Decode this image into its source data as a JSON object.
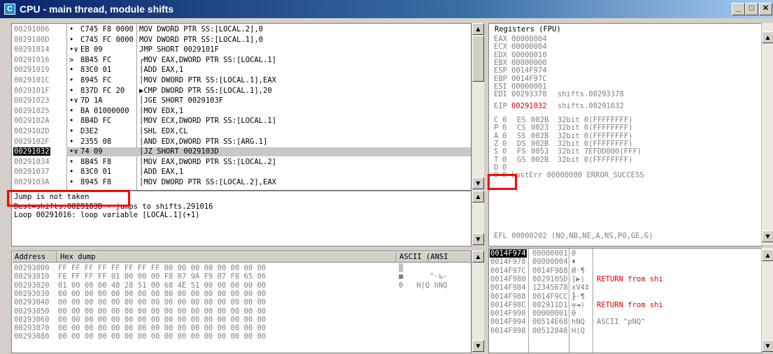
{
  "window": {
    "title": "CPU - main thread, module shifts",
    "icon_letter": "C",
    "minimize": "_",
    "maximize": "□",
    "close": "✕"
  },
  "disasm": {
    "rows": [
      {
        "addr": "00291006",
        "mark": "•",
        "bytes": "C745 F8 0000",
        "instr": "MOV DWORD PTR SS:[LOCAL.2],0"
      },
      {
        "addr": "0029100D",
        "mark": "•",
        "bytes": "C745 FC 0000",
        "instr": "MOV DWORD PTR SS:[LOCAL.1],0"
      },
      {
        "addr": "00291014",
        "mark": "•∨",
        "bytes": "EB 09",
        "instr": "JMP SHORT 0029101F"
      },
      {
        "addr": "00291016",
        "mark": ">",
        "bytes": "8B45 FC",
        "instr": "┌MOV EAX,DWORD PTR SS:[LOCAL.1]"
      },
      {
        "addr": "00291019",
        "mark": "•",
        "bytes": "83C0 01",
        "instr": "│ADD EAX,1"
      },
      {
        "addr": "0029101C",
        "mark": "•",
        "bytes": "8945 FC",
        "instr": "│MOV DWORD PTR SS:[LOCAL.1],EAX"
      },
      {
        "addr": "0029101F",
        "mark": "•",
        "bytes": "837D FC 20",
        "instr": "▶CMP DWORD PTR SS:[LOCAL.1],20"
      },
      {
        "addr": "00291023",
        "mark": "•∨",
        "bytes": "7D 1A",
        "instr": "│JGE SHORT 0029103F"
      },
      {
        "addr": "00291025",
        "mark": "•",
        "bytes": "BA 01000000",
        "instr": "│MOV EDX,1"
      },
      {
        "addr": "0029102A",
        "mark": "•",
        "bytes": "8B4D FC",
        "instr": "│MOV ECX,DWORD PTR SS:[LOCAL.1]"
      },
      {
        "addr": "0029102D",
        "mark": "•",
        "bytes": "D3E2",
        "instr": "│SHL EDX,CL"
      },
      {
        "addr": "0029102F",
        "mark": "•",
        "bytes": "2355 08",
        "instr": "│AND EDX,DWORD PTR SS:[ARG.1]"
      },
      {
        "addr": "00291032",
        "mark": "•∨",
        "bytes": "74 09",
        "instr": "│JZ SHORT 0029103D"
      },
      {
        "addr": "00291034",
        "mark": "•",
        "bytes": "8B45 F8",
        "instr": "│MOV EAX,DWORD PTR SS:[LOCAL.2]"
      },
      {
        "addr": "00291037",
        "mark": "•",
        "bytes": "83C0 01",
        "instr": "│ADD EAX,1"
      },
      {
        "addr": "0029103A",
        "mark": "•",
        "bytes": "8945 F8",
        "instr": "│MOV DWORD PTR SS:[LOCAL.2],EAX"
      }
    ]
  },
  "info": {
    "line1": "Jump is not taken",
    "line2": "Dest=shifts.0029103D - jumps to shifts.291016",
    "line3": "Loop 00291016: loop variable [LOCAL.1](+1)"
  },
  "registers": {
    "header": "Registers (FPU)",
    "gprs": [
      {
        "name": "EAX",
        "value": "00000004",
        "comment": ""
      },
      {
        "name": "ECX",
        "value": "00000004",
        "comment": ""
      },
      {
        "name": "EDX",
        "value": "00000010",
        "comment": ""
      },
      {
        "name": "EBX",
        "value": "00000000",
        "comment": ""
      },
      {
        "name": "ESP",
        "value": "0014F974",
        "comment": ""
      },
      {
        "name": "EBP",
        "value": "0014F97C",
        "comment": ""
      },
      {
        "name": "ESI",
        "value": "00000001",
        "comment": ""
      },
      {
        "name": "EDI",
        "value": "00293378",
        "comment": "shifts.00293378"
      }
    ],
    "eip": {
      "name": "EIP",
      "value": "00291032",
      "comment": "shifts.00291032"
    },
    "flags": [
      {
        "flag": "C",
        "val": "0",
        "seg": "ES",
        "sel": "002B",
        "desc": "32bit 0(FFFFFFFF)"
      },
      {
        "flag": "P",
        "val": "0",
        "seg": "CS",
        "sel": "0023",
        "desc": "32bit 0(FFFFFFFF)"
      },
      {
        "flag": "A",
        "val": "0",
        "seg": "SS",
        "sel": "002B",
        "desc": "32bit 0(FFFFFFFF)"
      },
      {
        "flag": "Z",
        "val": "0",
        "seg": "DS",
        "sel": "002B",
        "desc": "32bit 0(FFFFFFFF)"
      },
      {
        "flag": "S",
        "val": "0",
        "seg": "FS",
        "sel": "0053",
        "desc": "32bit 7EFDD000(FFF)"
      },
      {
        "flag": "T",
        "val": "0",
        "seg": "GS",
        "sel": "002B",
        "desc": "32bit 0(FFFFFFFF)"
      },
      {
        "flag": "D",
        "val": "0",
        "seg": "",
        "sel": "",
        "desc": ""
      },
      {
        "flag": "O",
        "val": "0",
        "seg": "",
        "sel": "",
        "desc": "LastErr 00000000 ERROR_SUCCESS"
      }
    ],
    "efl": "EFL 00000202 (NO,NB,NE,A,NS,PO,GE,G)"
  },
  "dump": {
    "col_address": "Address",
    "col_hex": "Hex dump",
    "col_ascii": "ASCII (ANSI",
    "rows": [
      {
        "addr": "00293000",
        "hex": "FF FF FF FF FF FF FF FF 00 00 00 00 00 00 00 00",
        "ascii": "▒"
      },
      {
        "addr": "00293010",
        "hex": "FE FF FF FF 01 00 00 00 F8 07 9A F9 07 F8 65 06",
        "ascii": "■      °·ъ·"
      },
      {
        "addr": "00293020",
        "hex": "01 00 00 00 48 28 51 00 68 4E 51 00 00 00 00 00",
        "ascii": "θ   H(Q hNQ"
      },
      {
        "addr": "00293030",
        "hex": "00 00 00 00 00 00 00 00 00 00 00 00 00 00 00 00",
        "ascii": ""
      },
      {
        "addr": "00293040",
        "hex": "00 00 00 00 00 00 00 00 00 00 00 00 00 00 00 00",
        "ascii": ""
      },
      {
        "addr": "00293050",
        "hex": "00 00 00 00 00 00 00 00 00 00 00 00 00 00 00 00",
        "ascii": ""
      },
      {
        "addr": "00293060",
        "hex": "00 00 00 00 00 00 00 00 00 00 00 00 00 00 00 00",
        "ascii": ""
      },
      {
        "addr": "00293070",
        "hex": "00 00 00 00 00 00 00 00 00 00 00 00 00 00 00 00",
        "ascii": ""
      },
      {
        "addr": "00293080",
        "hex": "00 00 00 00 00 00 00 00 00 00 00 00 00 00 00 00",
        "ascii": ""
      }
    ]
  },
  "stack": {
    "rows": [
      {
        "addr": "0014F974",
        "val": "00000001",
        "ascii": "θ",
        "comment": ""
      },
      {
        "addr": "0014F978",
        "val": "00000004",
        "ascii": "♦",
        "comment": ""
      },
      {
        "addr": "0014F97C",
        "val": "0014F988",
        "ascii": "И·¶",
        "comment": ""
      },
      {
        "addr": "0014F980",
        "val": "0029105D",
        "ascii": "]▶)",
        "comment": "RETURN from shi"
      },
      {
        "addr": "0014F984",
        "val": "12345678",
        "ascii": "xV4‡",
        "comment": ""
      },
      {
        "addr": "0014F988",
        "val": "0014F9CC",
        "ascii": "╟·¶",
        "comment": ""
      },
      {
        "addr": "0014F98C",
        "val": "002911D1",
        "ascii": "╤◄)",
        "comment": "RETURN from shi"
      },
      {
        "addr": "0014F990",
        "val": "00000001",
        "ascii": "θ",
        "comment": ""
      },
      {
        "addr": "0014F994",
        "val": "00514E68",
        "ascii": "hNQ",
        "comment": "ASCII \"pNQ\""
      },
      {
        "addr": "0014F998",
        "val": "00512848",
        "ascii": "H(Q",
        "comment": ""
      }
    ]
  }
}
